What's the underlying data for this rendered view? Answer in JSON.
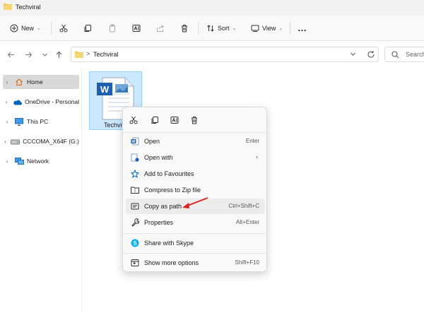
{
  "window": {
    "title": "Techviral"
  },
  "toolbar": {
    "new_label": "New",
    "sort_label": "Sort",
    "view_label": "View",
    "more_label": "…"
  },
  "address": {
    "separator": ">",
    "crumb": "Techviral",
    "search_placeholder": "Search"
  },
  "sidebar": {
    "items": [
      {
        "label": "Home",
        "icon": "home-icon"
      },
      {
        "label": "OneDrive - Personal",
        "icon": "onedrive-icon"
      },
      {
        "label": "This PC",
        "icon": "pc-icon"
      },
      {
        "label": "CCCOMA_X64F (G:)",
        "icon": "drive-icon"
      },
      {
        "label": "Network",
        "icon": "network-icon"
      }
    ]
  },
  "file": {
    "name": "Techviral"
  },
  "context_menu": {
    "items": [
      {
        "label": "Open",
        "shortcut": "Enter",
        "icon": "word-doc-icon"
      },
      {
        "label": "Open with",
        "shortcut": "",
        "icon": "open-with-icon"
      },
      {
        "label": "Add to Favourites",
        "shortcut": "",
        "icon": "star-icon"
      },
      {
        "label": "Compress to Zip file",
        "shortcut": "",
        "icon": "zip-folder-icon"
      },
      {
        "label": "Copy as path",
        "shortcut": "Ctrl+Shift+C",
        "icon": "copy-path-icon"
      },
      {
        "label": "Properties",
        "shortcut": "Alt+Enter",
        "icon": "wrench-icon"
      },
      {
        "label": "Share with Skype",
        "shortcut": "",
        "icon": "skype-icon"
      },
      {
        "label": "Show more options",
        "shortcut": "Shift+F10",
        "icon": "more-options-icon"
      }
    ],
    "highlighted": "Copy as path"
  },
  "colors": {
    "accent": "#0067c0",
    "folder": "#f2c94c",
    "arrow": "#e02020",
    "selection": "#cce8ff"
  }
}
